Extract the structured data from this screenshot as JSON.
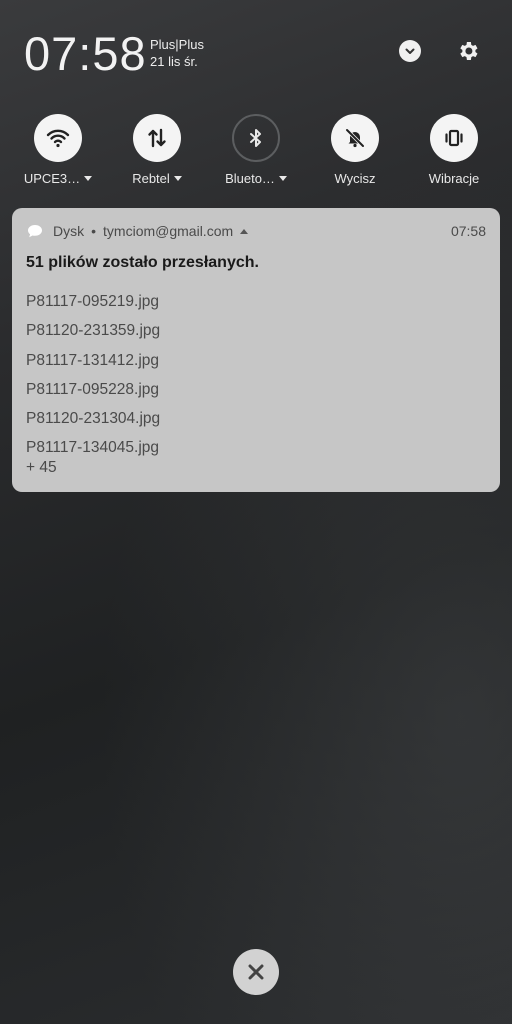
{
  "status": {
    "clock": "07:58",
    "carrier": "Plus|Plus",
    "date": "21 lis śr."
  },
  "quick_settings": [
    {
      "label": "UPCE3…",
      "icon": "wifi-icon",
      "active": true,
      "has_menu": true
    },
    {
      "label": "Rebtel",
      "icon": "mobile-data-icon",
      "active": true,
      "has_menu": true
    },
    {
      "label": "Blueto…",
      "icon": "bluetooth-icon",
      "active": false,
      "has_menu": true
    },
    {
      "label": "Wycisz",
      "icon": "mute-icon",
      "active": true,
      "has_menu": false
    },
    {
      "label": "Wibracje",
      "icon": "vibrate-icon",
      "active": true,
      "has_menu": false
    }
  ],
  "notification": {
    "app": "Dysk",
    "account": "tymciom@gmail.com",
    "time": "07:58",
    "title": "51 plików zostało przesłanych.",
    "files": [
      "P81117-095219.jpg",
      "P81120-231359.jpg",
      "P81117-131412.jpg",
      "P81117-095228.jpg",
      "P81120-231304.jpg",
      "P81117-134045.jpg"
    ],
    "more": "+ 45"
  },
  "colors": {
    "card_bg": "#c6c6c6",
    "tile_active": "#f4f4f4",
    "background": "#242628"
  }
}
